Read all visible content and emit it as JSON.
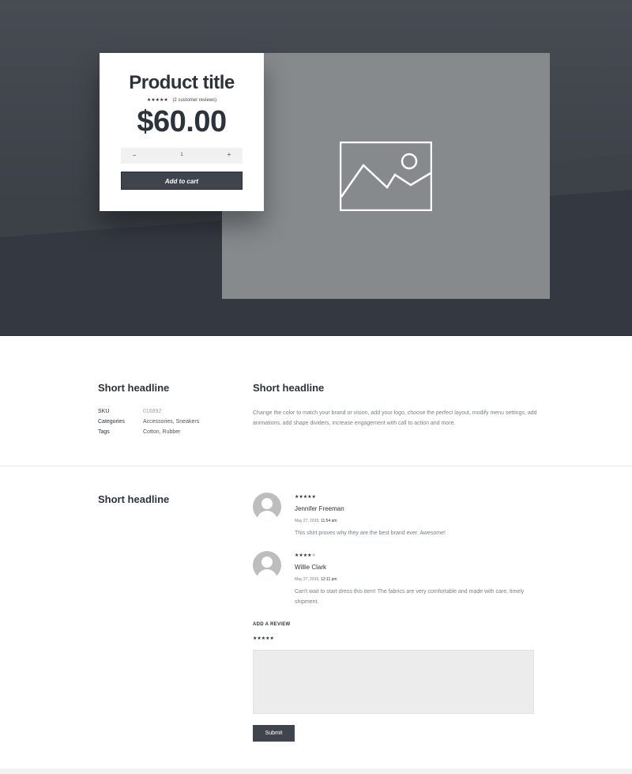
{
  "product": {
    "title": "Product title",
    "stars": "★★★★★",
    "rating_value": 4.5,
    "reviews_text": "(2 customer reviews)",
    "price": "$60.00",
    "qty_minus": "−",
    "qty_value": "1",
    "qty_plus": "+",
    "add_to_cart": "Add to cart"
  },
  "details": {
    "headline": "Short headline",
    "meta": [
      {
        "key": "SKU",
        "value": "016892"
      },
      {
        "key": "Categories",
        "value": "Accessories, Sneakers"
      },
      {
        "key": "Tags",
        "value": "Cotton, Rubber"
      }
    ],
    "description_headline": "Short headline",
    "description": "Change the color to match your brand or vision, add your logo, choose the perfect layout, modify menu settings, add animations, add shape dividers, increase engagement with call to action and more."
  },
  "reviews": {
    "headline": "Short headline",
    "items": [
      {
        "stars": "★★★★★",
        "rating": 5,
        "name": "Jennifer Freeman",
        "date": "May 27, 2015,",
        "time": "11:54 am",
        "text": "This shirt proves why they are the best brand ever. Awesome!"
      },
      {
        "stars": "★★★★★",
        "rating": 4,
        "name": "Willie Clark",
        "date": "May 27, 2015,",
        "time": "12:11 pm",
        "text": "Can't wait to start dress this item! The fabrics are very comfortable and made with care, timely shipment."
      }
    ],
    "add_review_label": "ADD A REVIEW",
    "add_review_stars": "★★★★★",
    "submit": "Submit"
  },
  "icons": {
    "image_placeholder": "image-placeholder-icon",
    "avatar": "user-avatar-icon"
  },
  "colors": {
    "accent_dark": "#40454d",
    "hero_bg": "#474c53",
    "image_panel": "#868a8d"
  }
}
